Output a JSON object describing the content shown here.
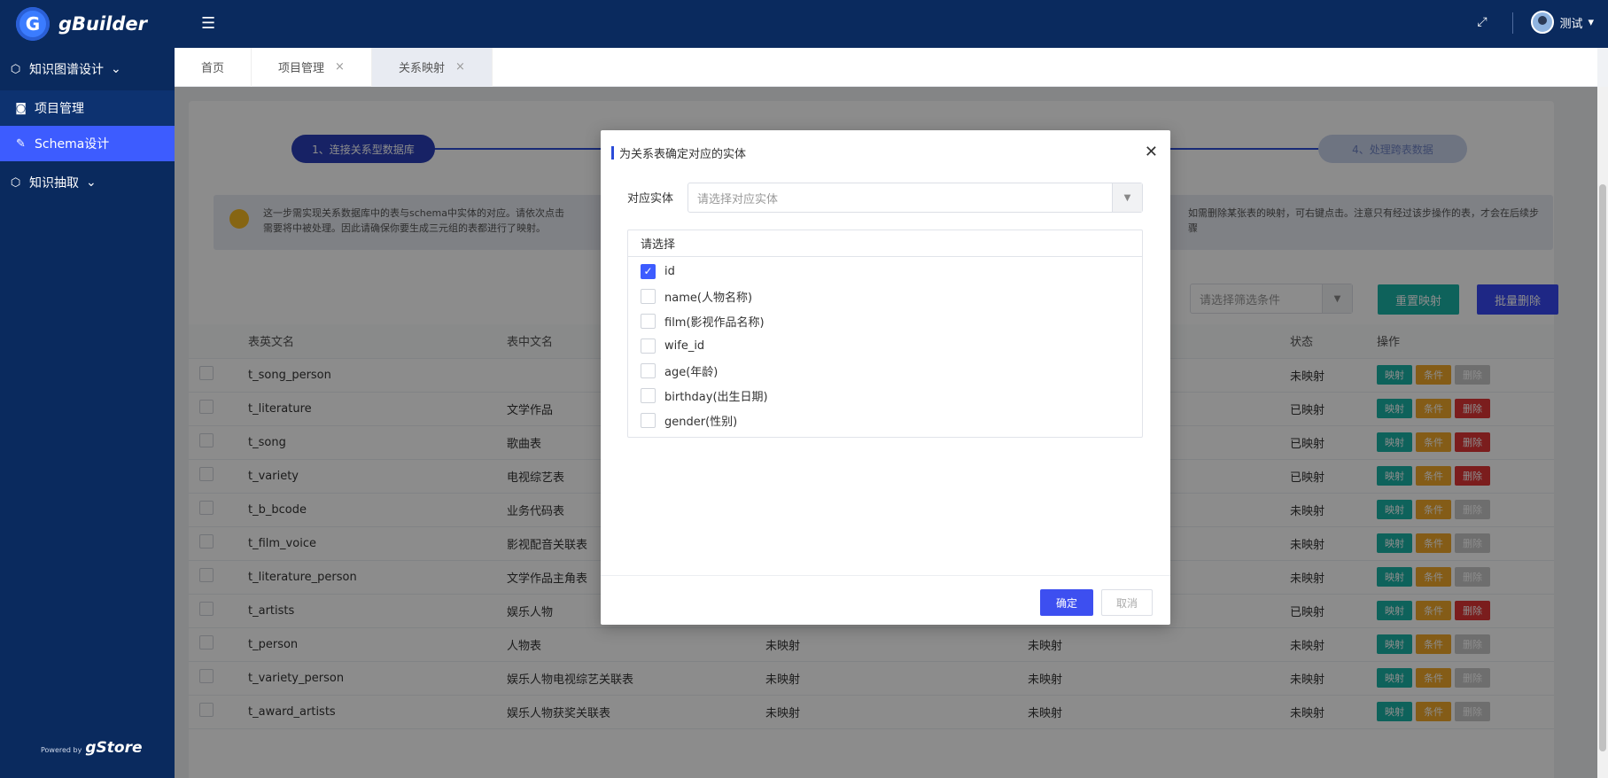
{
  "app": {
    "title": "gBuilder",
    "powered_by_label": "Powered by",
    "powered_by_name": "gStore"
  },
  "topbar": {
    "user_name": "测试"
  },
  "sidebar": {
    "groups": [
      {
        "label": "知识图谱设计",
        "items": [
          {
            "label": "项目管理"
          },
          {
            "label": "Schema设计"
          }
        ]
      },
      {
        "label": "知识抽取"
      }
    ]
  },
  "tabs": [
    {
      "label": "首页"
    },
    {
      "label": "项目管理"
    },
    {
      "label": "关系映射"
    }
  ],
  "steps": {
    "step1": "1、连接关系型数据库",
    "step4": "4、处理跨表数据"
  },
  "tip": {
    "left": "这一步需实现关系数据库中的表与schema中实体的对应。请依次点击需要将中被处理。因此请确保你要生成三元组的表都进行了映射。",
    "right": "如需删除某张表的映射，可右键点击。注意只有经过该步操作的表，才会在后续步骤"
  },
  "filter": {
    "placeholder": "请选择筛选条件",
    "remap_label": "重置映射",
    "batch_delete_label": "批量删除"
  },
  "table": {
    "headers": {
      "en_name": "表英文名",
      "cn_name": "表中文名",
      "status": "状态",
      "ops": "操作"
    },
    "op_labels": {
      "map": "映射",
      "cond": "条件",
      "del": "删除"
    },
    "rows": [
      {
        "en": "t_song_person",
        "cn": "",
        "c3": "",
        "c4": "",
        "status": "未映射",
        "mapped": false
      },
      {
        "en": "t_literature",
        "cn": "文学作品",
        "c3": "",
        "c4": "",
        "status": "已映射",
        "mapped": true
      },
      {
        "en": "t_song",
        "cn": "歌曲表",
        "c3": "",
        "c4": "",
        "status": "已映射",
        "mapped": true
      },
      {
        "en": "t_variety",
        "cn": "电视综艺表",
        "c3": "",
        "c4": "",
        "status": "已映射",
        "mapped": true
      },
      {
        "en": "t_b_bcode",
        "cn": "业务代码表",
        "c3": "",
        "c4": "",
        "status": "未映射",
        "mapped": false
      },
      {
        "en": "t_film_voice",
        "cn": "影视配音关联表",
        "c3": "",
        "c4": "",
        "status": "未映射",
        "mapped": false
      },
      {
        "en": "t_literature_person",
        "cn": "文学作品主角表",
        "c3": "",
        "c4": "",
        "status": "未映射",
        "mapped": false
      },
      {
        "en": "t_artists",
        "cn": "娱乐人物",
        "c3": "",
        "c4": "",
        "status": "已映射",
        "mapped": true
      },
      {
        "en": "t_person",
        "cn": "人物表",
        "c3": "未映射",
        "c4": "未映射",
        "status": "未映射",
        "mapped": false
      },
      {
        "en": "t_variety_person",
        "cn": "娱乐人物电视综艺关联表",
        "c3": "未映射",
        "c4": "未映射",
        "status": "未映射",
        "mapped": false
      },
      {
        "en": "t_award_artists",
        "cn": "娱乐人物获奖关联表",
        "c3": "未映射",
        "c4": "未映射",
        "status": "未映射",
        "mapped": false
      }
    ]
  },
  "modal": {
    "title": "为关系表确定对应的实体",
    "entity_label": "对应实体",
    "entity_placeholder": "请选择对应实体",
    "choose_title": "请选择",
    "options": [
      {
        "label": "id",
        "checked": true
      },
      {
        "label": "name(人物名称)",
        "checked": false
      },
      {
        "label": "film(影视作品名称)",
        "checked": false
      },
      {
        "label": "wife_id",
        "checked": false
      },
      {
        "label": "age(年龄)",
        "checked": false
      },
      {
        "label": "birthday(出生日期)",
        "checked": false
      },
      {
        "label": "gender(性别)",
        "checked": false
      }
    ],
    "ok_label": "确定",
    "cancel_label": "取消"
  }
}
